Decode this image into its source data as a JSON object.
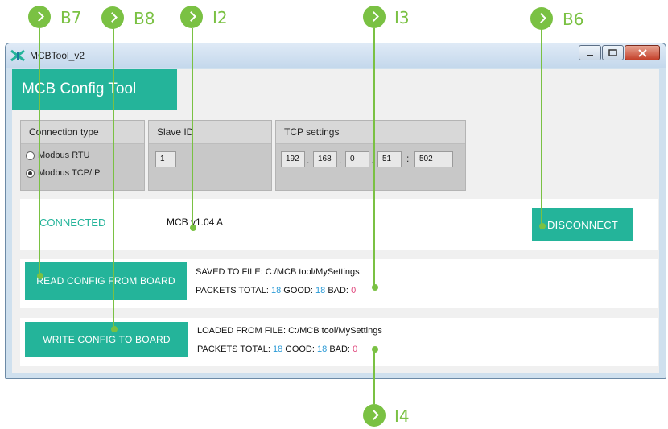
{
  "window": {
    "title": "MCBTool_v2"
  },
  "header": {
    "title": "MCB Config Tool"
  },
  "connection_type": {
    "title": "Connection type",
    "options": [
      {
        "label": "Modbus RTU",
        "selected": false
      },
      {
        "label": "Modbus TCP/IP",
        "selected": true
      }
    ]
  },
  "slave": {
    "title": "Slave ID",
    "value": "1"
  },
  "tcp": {
    "title": "TCP settings",
    "octets": [
      "192",
      "168",
      "0",
      "51"
    ],
    "port": "502",
    "dot": ".",
    "colon": ":"
  },
  "status": {
    "state": "CONNECTED",
    "version": "MCB v1.04 A",
    "disconnect_label": "DISCONNECT"
  },
  "read": {
    "button": "READ CONFIG FROM BOARD",
    "file_line": "SAVED TO FILE: C:/MCB tool/MySettings",
    "packets_label": "PACKETS  TOTAL:",
    "total": "18",
    "good_label": "GOOD:",
    "good": "18",
    "bad_label": "BAD:",
    "bad": "0"
  },
  "write": {
    "button": "WRITE CONFIG TO BOARD",
    "file_line": "LOADED FROM FILE: C:/MCB tool/MySettings",
    "packets_label": "PACKETS  TOTAL:",
    "total": "18",
    "good_label": "GOOD:",
    "good": "18",
    "bad_label": "BAD:",
    "bad": "0"
  },
  "callouts": [
    "B7",
    "B8",
    "I2",
    "I3",
    "B6",
    "I4"
  ],
  "colors": {
    "accent": "#24b49a",
    "callout": "#7ac143",
    "number": "#2a9ad6",
    "bad": "#e0457b"
  }
}
